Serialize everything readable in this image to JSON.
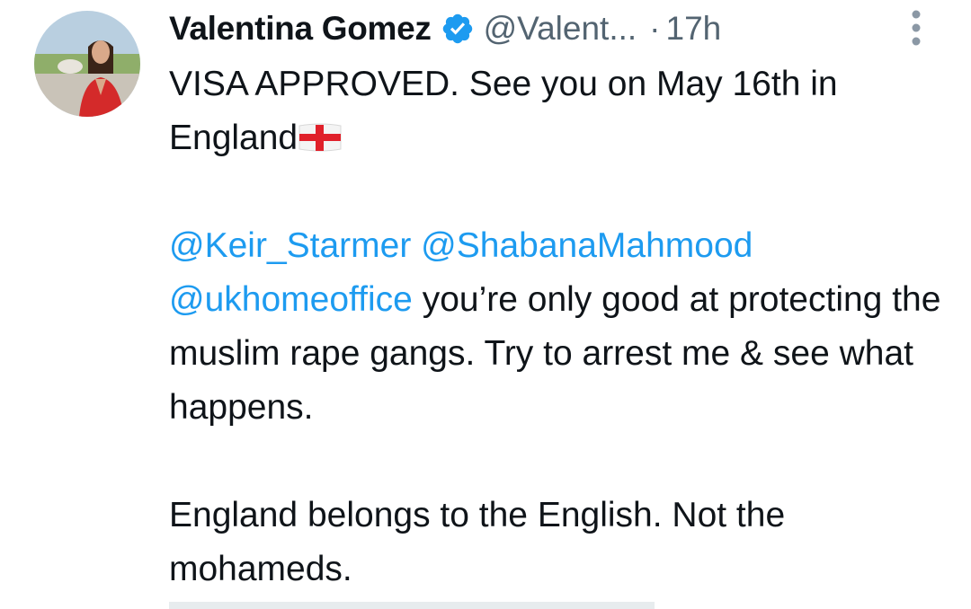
{
  "author": {
    "name": "Valentina Gomez",
    "handle": "@Valent...",
    "separator": "·",
    "time": "17h",
    "verified": true
  },
  "tweet": {
    "line1": "VISA APPROVED. See you on May 16th in England",
    "mentions": [
      "@Keir_Starmer",
      "@ShabanaMahmood",
      "@ukhomeoffice"
    ],
    "line2_rest": " you’re only good at protecting the muslim rape gangs. Try to arrest me & see what happens.",
    "line3": "England belongs to the English. Not the mohameds."
  },
  "icons": {
    "verified": "verified-badge-icon",
    "more": "more-vertical-icon",
    "flag": "england-flag-emoji"
  },
  "colors": {
    "link": "#1d9bf0",
    "secondary_text": "#536471",
    "verified": "#1d9bf0"
  }
}
